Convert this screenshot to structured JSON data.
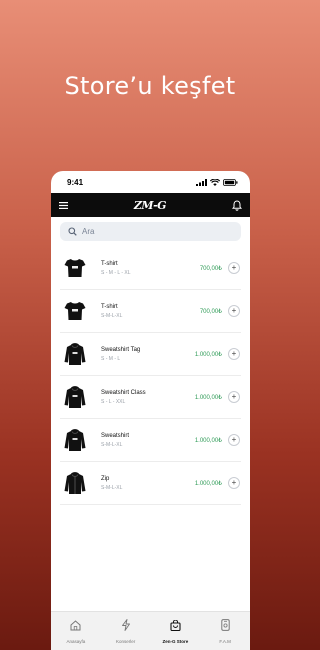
{
  "headline": "Store’u keşfet",
  "status": {
    "time": "9:41"
  },
  "appbar": {
    "logo": "ZM-G"
  },
  "search": {
    "placeholder": "Ara"
  },
  "products": [
    {
      "name": "T-shirt",
      "sizes": "S - M - L - XL",
      "price": "700,00₺",
      "icon": "tshirt-icon"
    },
    {
      "name": "T-shirt",
      "sizes": "S-M-L-XL",
      "price": "700,00₺",
      "icon": "tshirt-icon"
    },
    {
      "name": "Sweatshirt Tag",
      "sizes": "S - M - L",
      "price": "1.000,00₺",
      "icon": "hoodie-icon"
    },
    {
      "name": "Sweatshirt Class",
      "sizes": "S - L - XXL",
      "price": "1.000,00₺",
      "icon": "hoodie-icon"
    },
    {
      "name": "Sweatshirt",
      "sizes": "S-M-L-XL",
      "price": "1.000,00₺",
      "icon": "hoodie-icon"
    },
    {
      "name": "Zip",
      "sizes": "S-M-L-XL",
      "price": "1.000,00₺",
      "icon": "zip-hoodie-icon"
    }
  ],
  "nav": [
    {
      "label": "Anasayfa",
      "icon": "home-icon"
    },
    {
      "label": "Konserler",
      "icon": "lightning-icon"
    },
    {
      "label": "Zen-G Store",
      "icon": "store-bag-icon",
      "active": true
    },
    {
      "label": "F.A.M",
      "icon": "phone-icon"
    }
  ],
  "colors": {
    "price": "#2f9b57",
    "appbar": "#0c0c0c"
  }
}
